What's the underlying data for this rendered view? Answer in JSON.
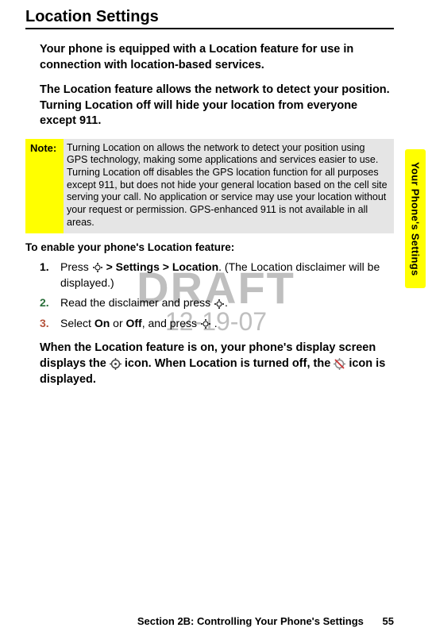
{
  "heading": "Location Settings",
  "intro1": "Your phone is equipped with a Location feature for use in connection with location-based services.",
  "intro2": "The Location feature allows the network to detect your position. Turning Location off will hide your location from everyone except 911.",
  "note": {
    "label": "Note:",
    "body": "Turning Location on allows the network to detect your position using GPS technology, making some applications and services easier to use. Turning Location off disables the GPS location function for all purposes except 911, but does not hide your general location based on the cell site serving your call. No application or service may use your location without your request or permission. GPS-enhanced 911 is not available in all areas."
  },
  "watermark": {
    "line1": "DRAFT",
    "line2": "12-19-07"
  },
  "subhead": "To enable your phone's Location feature:",
  "steps": [
    {
      "num": "1.",
      "pre": "Press ",
      "bold": " > Settings > Location",
      "post": ". (The Location disclaimer will be displayed.)"
    },
    {
      "num": "2.",
      "pre": "Read the disclaimer and press ",
      "post": "."
    },
    {
      "num": "3.",
      "pre": "Select ",
      "bold1": "On",
      "mid": " or ",
      "bold2": "Off",
      "post": ", and press ",
      "tail": "   ."
    }
  ],
  "post_para": {
    "t1": "When the Location feature is on, your phone's display screen displays the ",
    "t2": " icon. When Location is turned off, the ",
    "t3": " icon is displayed."
  },
  "side_tab": "Your Phone's Settings",
  "footer": {
    "section": "Section 2B: Controlling Your Phone's Settings",
    "page": "55"
  }
}
